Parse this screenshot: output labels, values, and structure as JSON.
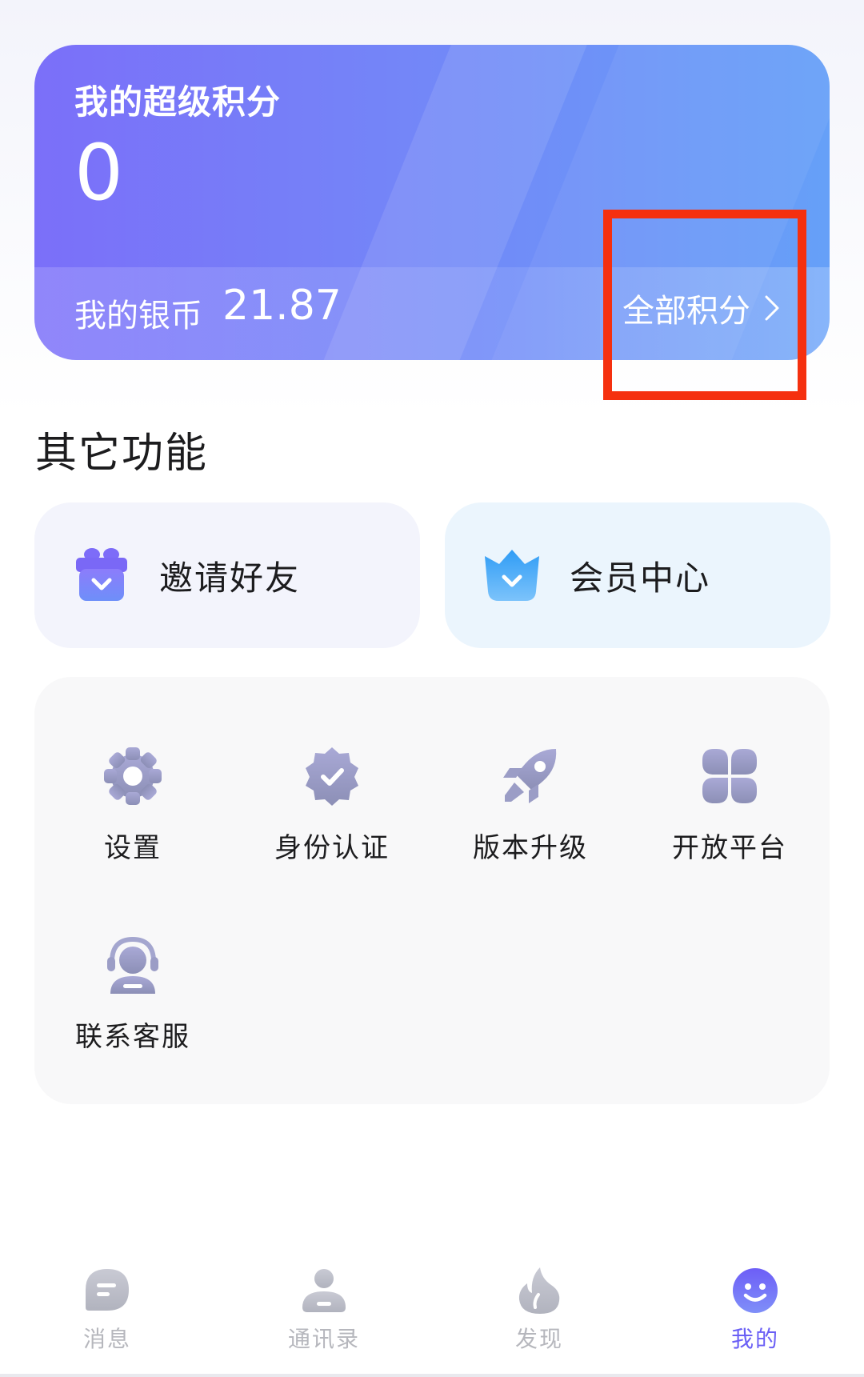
{
  "points_card": {
    "title": "我的超级积分",
    "points_value": "0",
    "silver_label": "我的银币",
    "silver_value": "21.87",
    "all_points_label": "全部积分"
  },
  "section": {
    "title": "其它功能"
  },
  "quick_actions": [
    {
      "label": "邀请好友",
      "icon": "gift-icon"
    },
    {
      "label": "会员中心",
      "icon": "crown-icon"
    }
  ],
  "features": [
    {
      "label": "设置",
      "icon": "gear-icon"
    },
    {
      "label": "身份认证",
      "icon": "verified-badge-icon"
    },
    {
      "label": "版本升级",
      "icon": "rocket-icon"
    },
    {
      "label": "开放平台",
      "icon": "four-petal-grid-icon"
    },
    {
      "label": "联系客服",
      "icon": "headset-agent-icon"
    }
  ],
  "tab_bar": {
    "active": "我的",
    "tabs": [
      {
        "label": "消息",
        "icon": "chat-bubble-icon"
      },
      {
        "label": "通讯录",
        "icon": "contacts-person-icon"
      },
      {
        "label": "发现",
        "icon": "flame-icon"
      },
      {
        "label": "我的",
        "icon": "smiley-face-icon"
      }
    ]
  },
  "colors": {
    "card_gradient_start": "#7b6ff9",
    "card_gradient_end": "#66a0f8",
    "accent": "#6a5ff5",
    "icon_gray": "#a6a8cc",
    "highlight": "#f5300f"
  }
}
